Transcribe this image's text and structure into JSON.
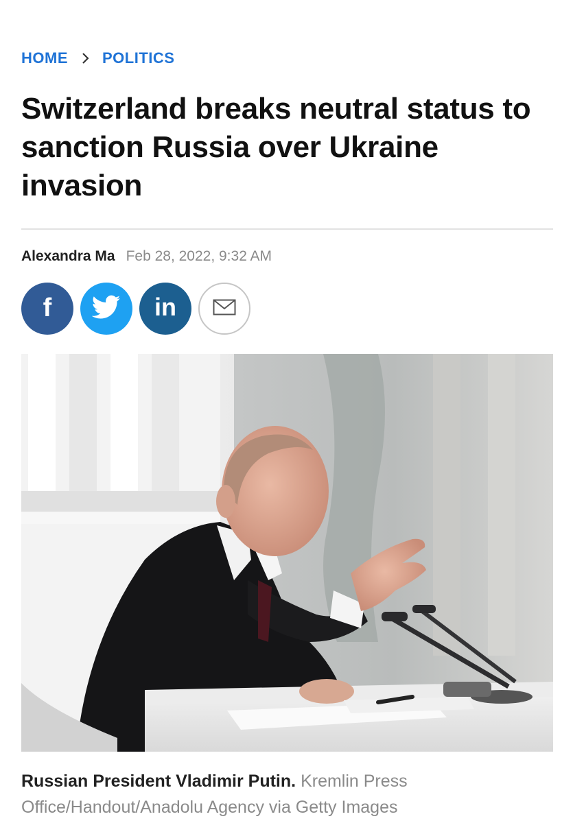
{
  "breadcrumb": {
    "home": "HOME",
    "section": "POLITICS",
    "separator_icon": "chevron-right-icon"
  },
  "article": {
    "title": "Switzerland breaks neutral status to sanction Russia over Ukraine invasion",
    "author": "Alexandra Ma",
    "date": "Feb 28, 2022, 9:32 AM"
  },
  "share": {
    "facebook_icon": "facebook-icon",
    "twitter_icon": "twitter-icon",
    "linkedin_icon": "linkedin-icon",
    "email_icon": "email-icon",
    "linkedin_text": "in",
    "facebook_text": "f"
  },
  "image": {
    "caption": "Russian President Vladimir Putin.",
    "credit": "Kremlin Press Office/Handout/Anadolu Agency via Getty Images"
  },
  "colors": {
    "link": "#1f73d6",
    "facebook": "#315b96",
    "twitter": "#1ea1f2",
    "linkedin": "#1c5f90",
    "meta_text": "#8a8a8a"
  }
}
